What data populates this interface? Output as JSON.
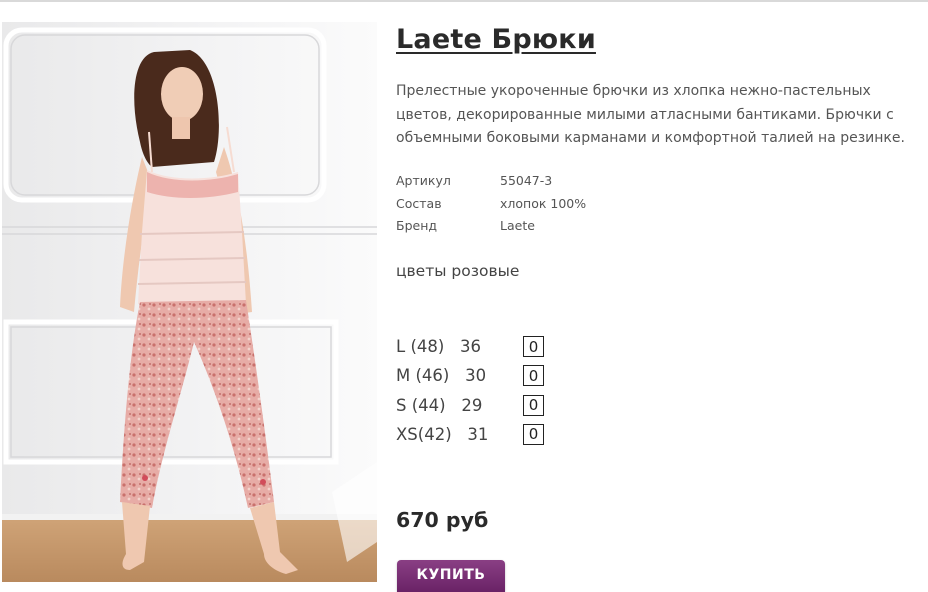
{
  "product": {
    "title": "Laete Брюки",
    "description": "Прелестные укороченные брючки из хлопка нежно-пастельных цветов, декорированные милыми атласными бантиками. Брючки с объемными боковыми карманами и комфортной талией на резинке.",
    "specs": [
      {
        "key": "Артикул",
        "value": "55047-3"
      },
      {
        "key": "Состав",
        "value": "хлопок 100%"
      },
      {
        "key": "Бренд",
        "value": "Laete"
      }
    ],
    "color_label": "цветы розовые",
    "sizes": [
      {
        "label": "L (48)   36",
        "qty": "0"
      },
      {
        "label": "M (46)   30",
        "qty": "0"
      },
      {
        "label": "S (44)   29",
        "qty": "0"
      },
      {
        "label": "XS(42)   31",
        "qty": "0"
      }
    ],
    "price": "670 руб",
    "buy_label": "КУПИТЬ"
  },
  "colors": {
    "button": "#7a2f76",
    "title": "#2a2a2a",
    "text": "#555555"
  }
}
